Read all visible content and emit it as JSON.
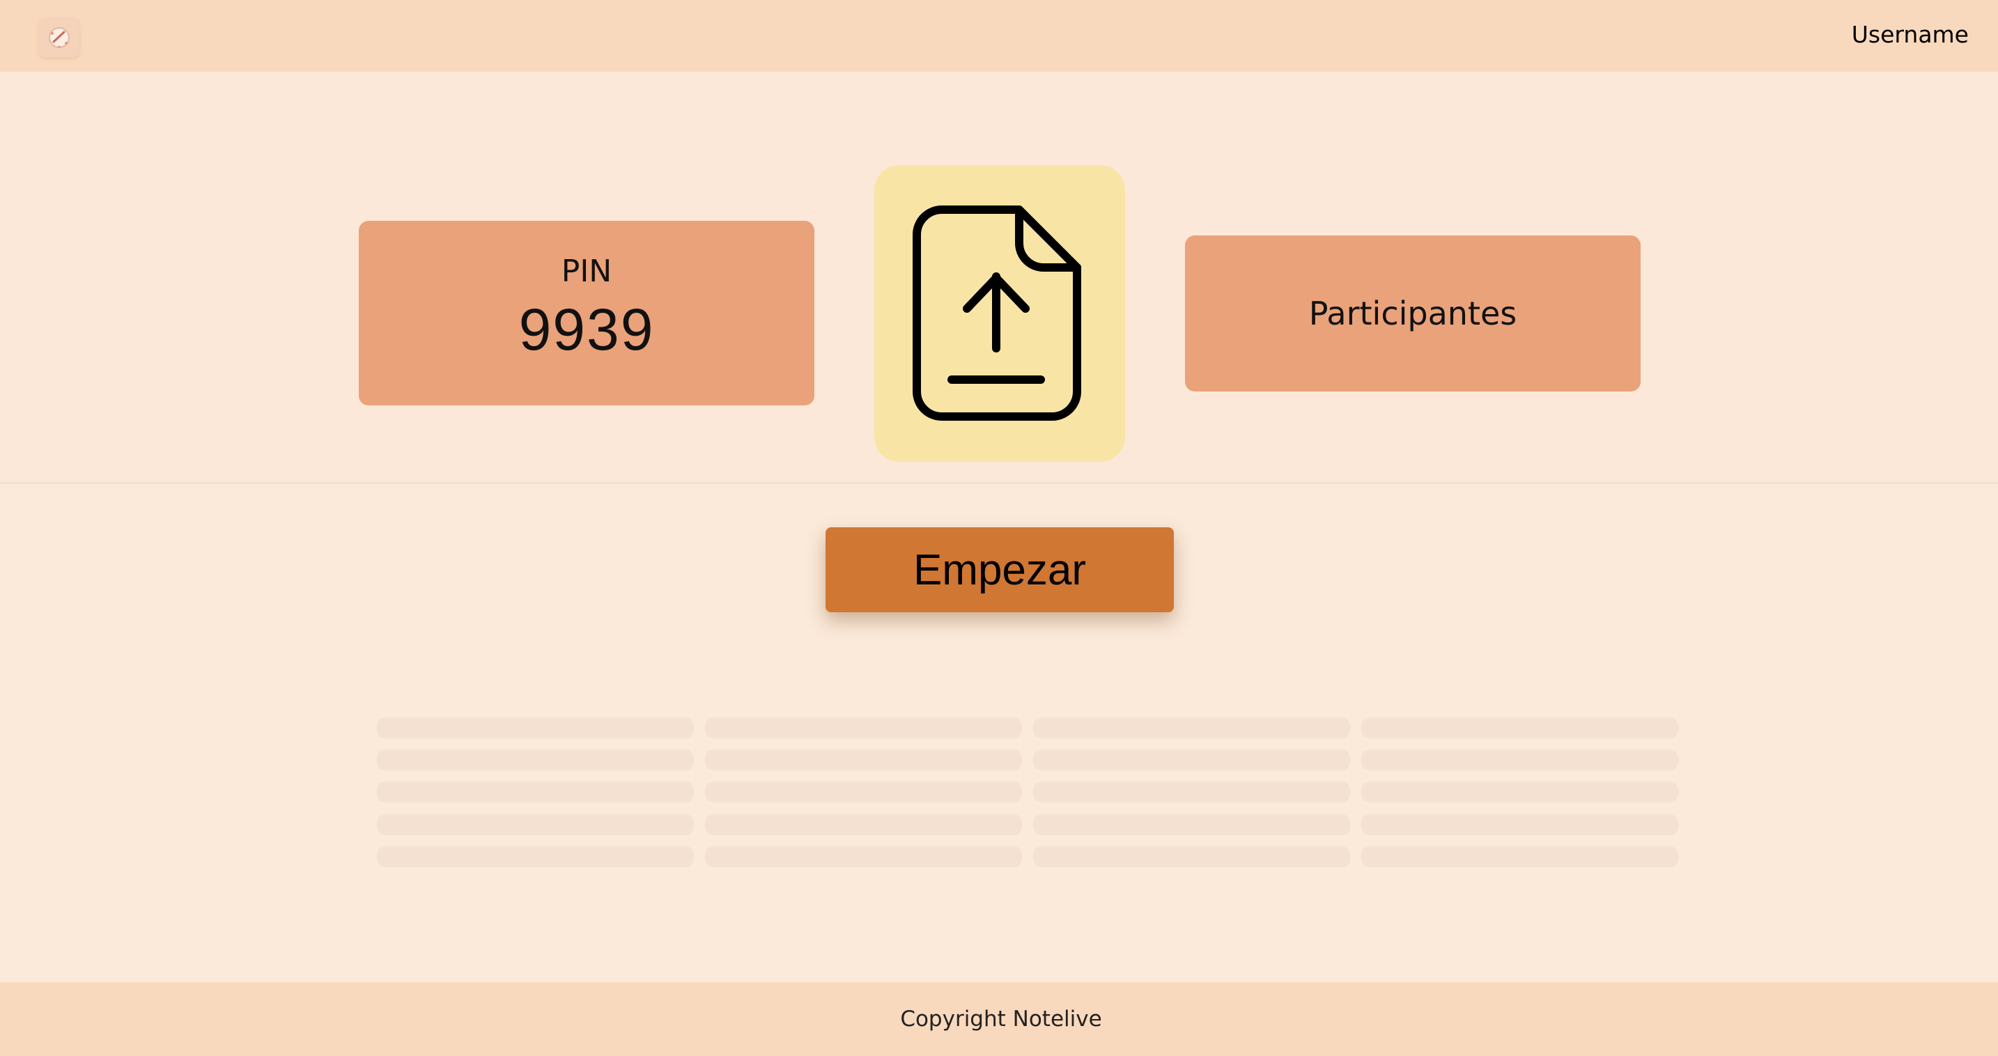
{
  "header": {
    "username": "Username"
  },
  "pin": {
    "label": "PIN",
    "value": "9939"
  },
  "upload": {
    "icon": "file-upload-icon"
  },
  "participants": {
    "label": "Participantes"
  },
  "actions": {
    "start_label": "Empezar"
  },
  "footer": {
    "copyright": "Copyright Notelive"
  },
  "colors": {
    "background": "#fbe9d9",
    "bar": "#f9d9bd",
    "card": "#eaa27a",
    "upload_card": "#f8e5a6",
    "primary_button": "#d07734"
  }
}
